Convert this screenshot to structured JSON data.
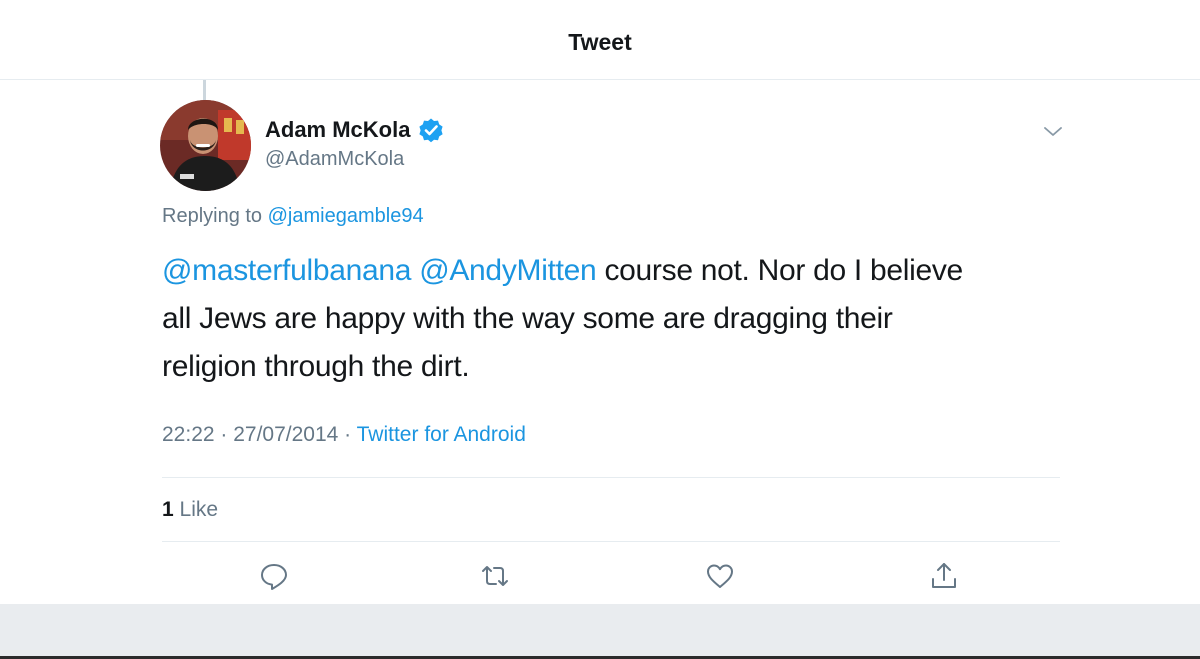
{
  "header": {
    "title": "Tweet"
  },
  "tweet": {
    "author": {
      "display_name": "Adam McKola",
      "handle": "@AdamMcKola",
      "verified": true,
      "avatar_icon": "profile-photo"
    },
    "replying_prefix": "Replying to ",
    "replying_to": "@jamiegamble94",
    "text": {
      "mention_1": "@masterfulbanana",
      "mention_2": "@AndyMitten",
      "line_1_rest": " course not. Nor do I believe",
      "line_2": "all Jews are happy with the way some are dragging their",
      "line_3": "religion through the dirt."
    },
    "time": "22:22",
    "date": "27/07/2014",
    "separator": " · ",
    "source": "Twitter for Android",
    "likes": {
      "count": "1",
      "label": " Like"
    },
    "actions": [
      "reply-icon",
      "retweet-icon",
      "like-icon",
      "share-icon"
    ]
  },
  "colors": {
    "link": "#1b95e0",
    "text": "#14171a",
    "muted": "#657786",
    "verified": "#1da1f2"
  }
}
